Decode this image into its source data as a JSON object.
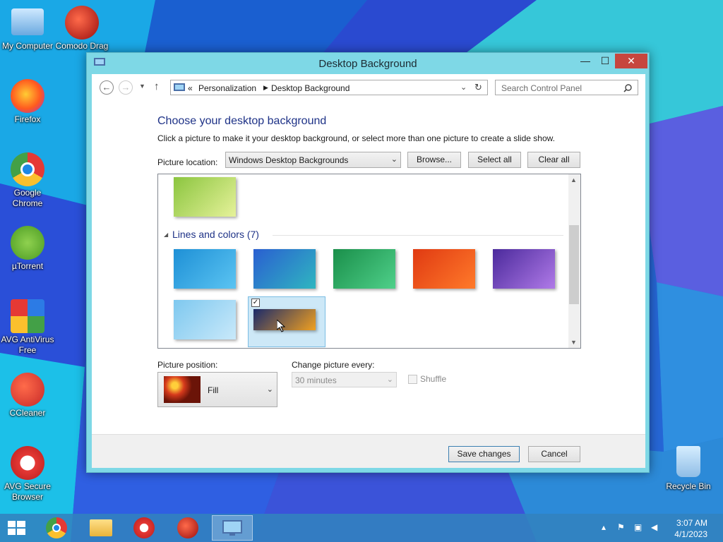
{
  "desktop": {
    "icons": [
      {
        "label": "My Computer",
        "icon": "computer-icon"
      },
      {
        "label": "Comodo Drag",
        "icon": "comodo-dragon-icon"
      },
      {
        "label": "Firefox",
        "icon": "firefox-icon"
      },
      {
        "label": "Google Chrome",
        "icon": "chrome-icon"
      },
      {
        "label": "µTorrent",
        "icon": "utorrent-icon"
      },
      {
        "label": "AVG AntiVirus Free",
        "icon": "avg-antivirus-icon"
      },
      {
        "label": "CCleaner",
        "icon": "ccleaner-icon"
      },
      {
        "label": "AVG Secure Browser",
        "icon": "avg-secure-browser-icon"
      },
      {
        "label": "Recycle Bin",
        "icon": "recycle-bin-icon"
      }
    ]
  },
  "window": {
    "title": "Desktop Background",
    "minimize": "—",
    "maximize": "☐",
    "close": "✕"
  },
  "address": {
    "prefix": "«",
    "crumbs": [
      "Personalization",
      "Desktop Background"
    ],
    "search_placeholder": "Search Control Panel"
  },
  "content": {
    "heading": "Choose your desktop background",
    "subtext": "Click a picture to make it your desktop background, or select more than one picture to create a slide show.",
    "location_label": "Picture location:",
    "location_value": "Windows Desktop Backgrounds",
    "browse_label": "Browse...",
    "select_all_label": "Select all",
    "clear_all_label": "Clear all"
  },
  "gallery": {
    "group_title": "Lines and colors (7)",
    "selected_index": 6,
    "thumbnails": [
      {
        "colors": [
          "#8bc53f",
          "#e6f29a"
        ]
      },
      {
        "colors": [
          "#1e90d6",
          "#5bc4f2"
        ]
      },
      {
        "colors": [
          "#2a5fd1",
          "#2fb6c0"
        ]
      },
      {
        "colors": [
          "#1a8f4a",
          "#4fd08a"
        ]
      },
      {
        "colors": [
          "#e03a12",
          "#ff7a2a"
        ]
      },
      {
        "colors": [
          "#4b2a9c",
          "#b07ae8"
        ]
      },
      {
        "colors": [
          "#7ec8ef",
          "#c9e9fa"
        ]
      },
      {
        "colors": [
          "#1a2a6b",
          "#f0a020"
        ]
      }
    ]
  },
  "position": {
    "label": "Picture position:",
    "value": "Fill"
  },
  "slideshow": {
    "label": "Change picture every:",
    "interval": "30 minutes",
    "shuffle_label": "Shuffle"
  },
  "footer": {
    "save_label": "Save changes",
    "cancel_label": "Cancel"
  },
  "taskbar": {
    "time": "3:07 AM",
    "date": "4/1/2023"
  }
}
